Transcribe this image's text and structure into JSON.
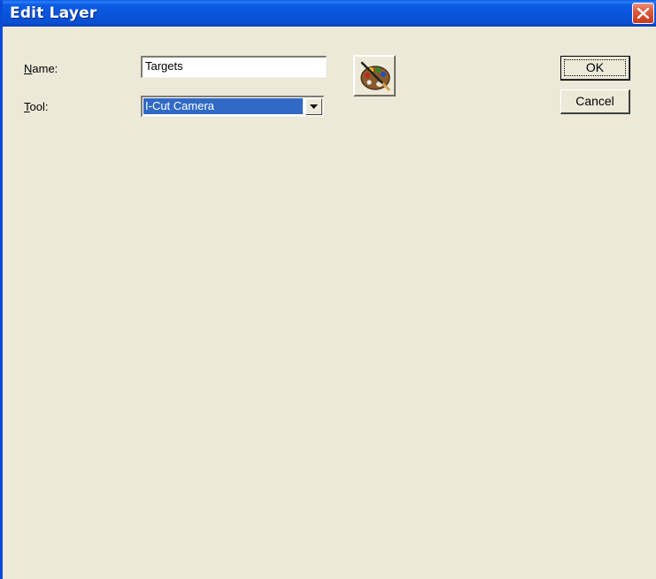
{
  "window": {
    "title": "Edit Layer",
    "close_icon": "close-icon"
  },
  "form": {
    "name_label_hotkey": "N",
    "name_label_rest": "ame:",
    "name_value": "Targets",
    "tool_label_hotkey": "T",
    "tool_label_rest": "ool:",
    "tool_value": "I-Cut Camera",
    "palette_icon": "color-palette-icon"
  },
  "buttons": {
    "ok_label": "OK",
    "cancel_label": "Cancel"
  },
  "colors": {
    "titlebar": "#0853d9",
    "dialog_bg": "#ece9d8",
    "selection": "#316ac5",
    "close": "#dd5a3e"
  }
}
